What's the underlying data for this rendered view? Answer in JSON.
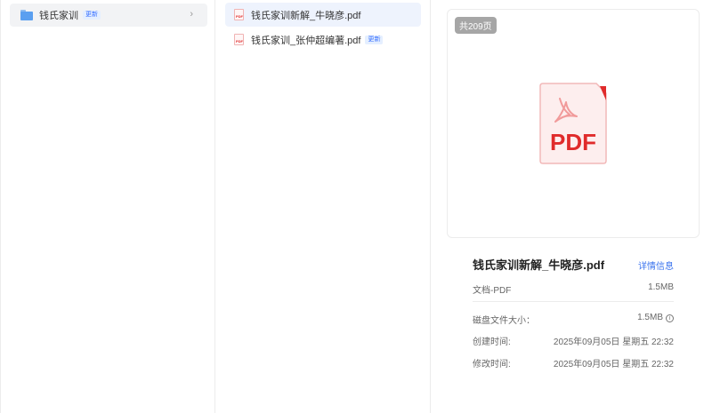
{
  "folders": [
    {
      "label": "钱氏家训",
      "badge": "更新",
      "chevron": "›"
    }
  ],
  "files": [
    {
      "name": "钱氏家训新解_牛晓彦.pdf",
      "badge": "",
      "selected": true
    },
    {
      "name": "钱氏家训_张仲超编著.pdf",
      "badge": "更新",
      "selected": false
    }
  ],
  "preview": {
    "page_count": "共209页",
    "icon_text": "PDF",
    "title": "钱氏家训新解_牛晓彦.pdf",
    "detail_link": "详情信息",
    "doc_type_label": "文档-PDF",
    "doc_type_size": "1.5MB",
    "disk_size_label": "磁盘文件大小：",
    "disk_size_value": "1.5MB",
    "created_label": "创建时间:",
    "created_value": "2025年09月05日 星期五 22:32",
    "modified_label": "修改时间:",
    "modified_value": "2025年09月05日 星期五 22:32"
  },
  "colors": {
    "accent": "#3a73ee",
    "pdf_red": "#e02b2b",
    "selected_bg": "#eef3fd"
  }
}
